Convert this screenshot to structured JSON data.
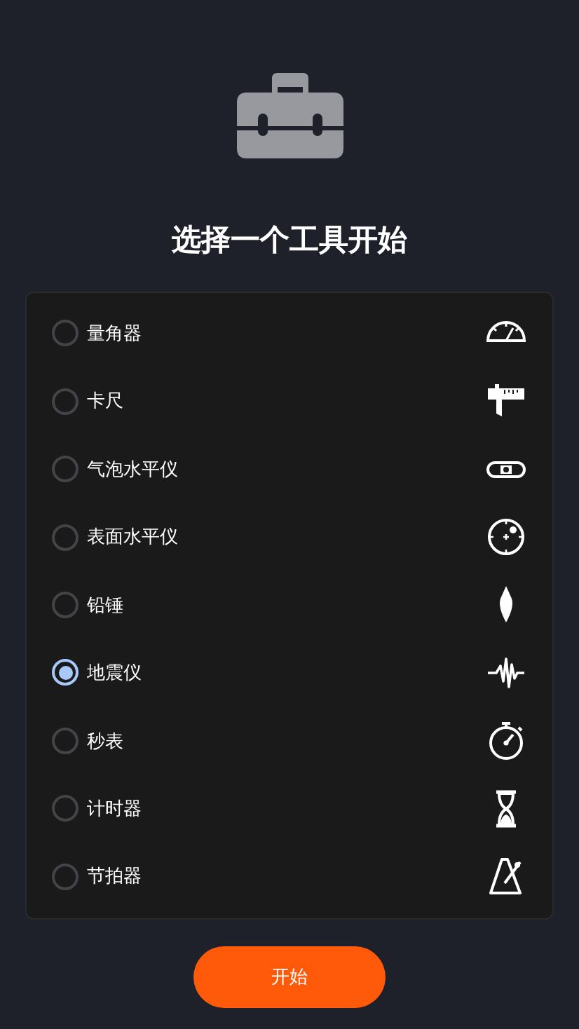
{
  "title": "选择一个工具开始",
  "tools": [
    {
      "label": "量角器",
      "kind": "protractor",
      "selected": false
    },
    {
      "label": "卡尺",
      "kind": "caliper",
      "selected": false
    },
    {
      "label": "气泡水平仪",
      "kind": "bubble_level",
      "selected": false
    },
    {
      "label": "表面水平仪",
      "kind": "dial",
      "selected": false
    },
    {
      "label": "铅锤",
      "kind": "plumb_bob",
      "selected": false
    },
    {
      "label": "地震仪",
      "kind": "waveform",
      "selected": true
    },
    {
      "label": "秒表",
      "kind": "stopwatch",
      "selected": false
    },
    {
      "label": "计时器",
      "kind": "hourglass",
      "selected": false
    },
    {
      "label": "节拍器",
      "kind": "metronome",
      "selected": false
    }
  ],
  "start_button": "开始"
}
